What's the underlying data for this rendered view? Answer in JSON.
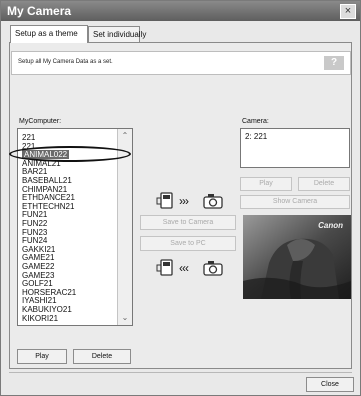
{
  "window": {
    "title": "My Camera",
    "close_glyph": "×"
  },
  "tabs": [
    {
      "label": "Setup as a theme",
      "active": true
    },
    {
      "label": "Set individually",
      "active": false
    }
  ],
  "info": {
    "text": "Setup all My Camera Data as a set.",
    "help_label": "?"
  },
  "mycomputer": {
    "label": "MyComputer:",
    "items": [
      "221",
      "221",
      "ANIMAL022",
      "ANIMAL21",
      "BAR21",
      "BASEBALL21",
      "CHIMPAN21",
      "ETHDANCE21",
      "ETHTECHN21",
      "FUN21",
      "FUN22",
      "FUN23",
      "FUN24",
      "GAKKI21",
      "GAME21",
      "GAME22",
      "GAME23",
      "GOLF21",
      "HORSERAC21",
      "IYASHI21",
      "KABUKIYO21",
      "KIKORI21"
    ],
    "selected_index": 2
  },
  "camera": {
    "label": "Camera:",
    "items": [
      "2: 221"
    ]
  },
  "buttons": {
    "cam_play": "Play",
    "cam_delete": "Delete",
    "show_camera": "Show Camera",
    "save_to_camera": "Save to Camera",
    "save_to_pc": "Save to PC",
    "play": "Play",
    "delete": "Delete",
    "close": "Close"
  },
  "arrows": {
    "to_camera": "›››",
    "to_pc": "‹‹‹"
  },
  "photo": {
    "brand": "Canon"
  },
  "icons": {
    "pc_card": "memory-card-icon",
    "camera": "camera-icon"
  }
}
